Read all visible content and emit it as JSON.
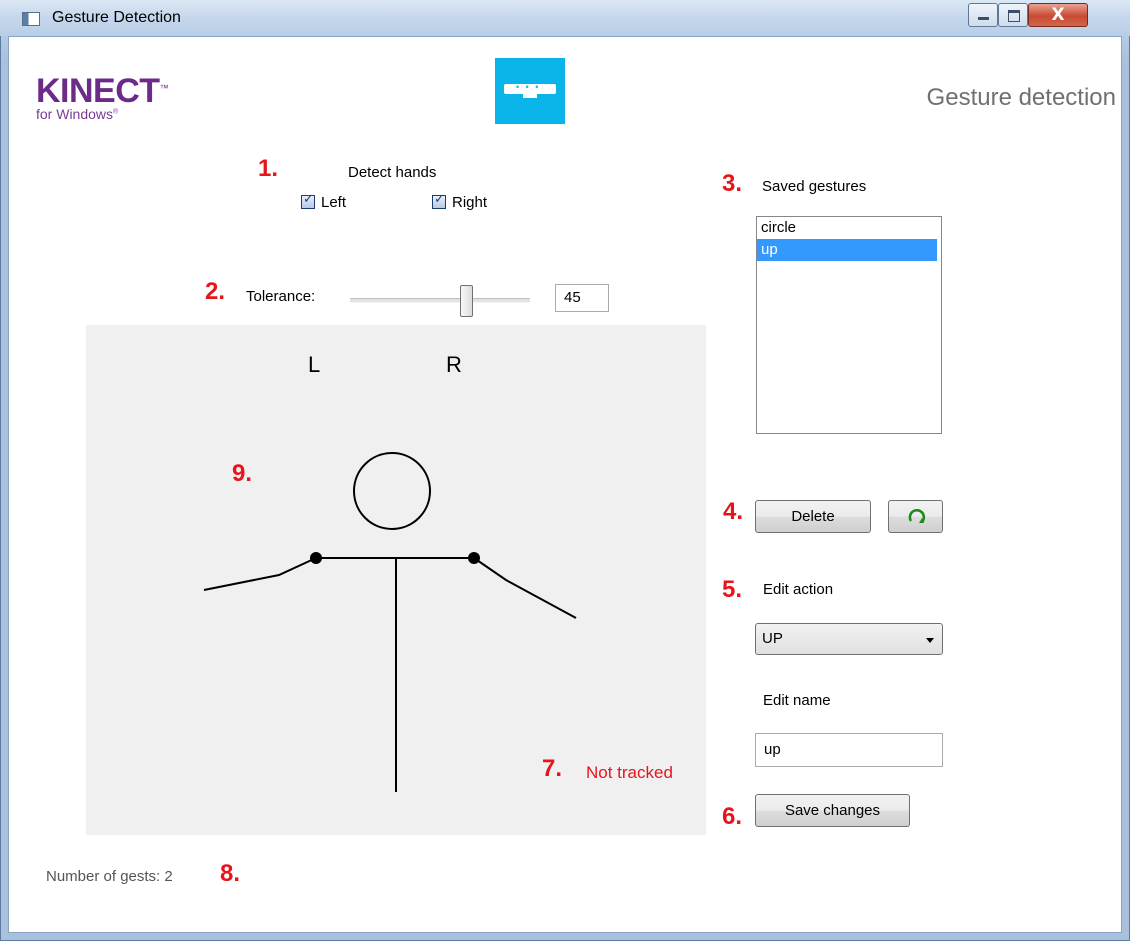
{
  "window": {
    "title": "Gesture Detection",
    "close_glyph": "X"
  },
  "header": {
    "logo_main": "KINECT",
    "logo_tm": "™",
    "logo_sub": "for Windows",
    "logo_sub_mark": "®",
    "sensor_icon": "kinect-sensor-icon",
    "page_heading": "Gesture detection",
    "brand_color": "#6c2b88",
    "tile_color": "#0bb4e8"
  },
  "annotations": {
    "n1": "1.",
    "n2": "2.",
    "n3": "3.",
    "n4": "4.",
    "n5": "5.",
    "n6": "6.",
    "n7": "7.",
    "n8": "8.",
    "n9": "9.",
    "color": "#e8141a"
  },
  "detect_hands": {
    "label": "Detect hands",
    "left_label": "Left",
    "left_checked": true,
    "right_label": "Right",
    "right_checked": true
  },
  "tolerance": {
    "label": "Tolerance:",
    "value": "45"
  },
  "skeleton_view": {
    "left_marker": "L",
    "right_marker": "R",
    "status": "Not tracked",
    "background": "#f0f0f0"
  },
  "saved_gestures": {
    "label": "Saved gestures",
    "items": [
      "circle",
      "up"
    ],
    "selected_index": 1
  },
  "actions": {
    "delete_label": "Delete",
    "refresh_icon": "refresh-icon"
  },
  "edit_action": {
    "label": "Edit action",
    "selected": "UP"
  },
  "edit_name": {
    "label": "Edit name",
    "value": "up"
  },
  "save": {
    "label": "Save changes"
  },
  "footer": {
    "count_text": "Number of gests: 2"
  }
}
